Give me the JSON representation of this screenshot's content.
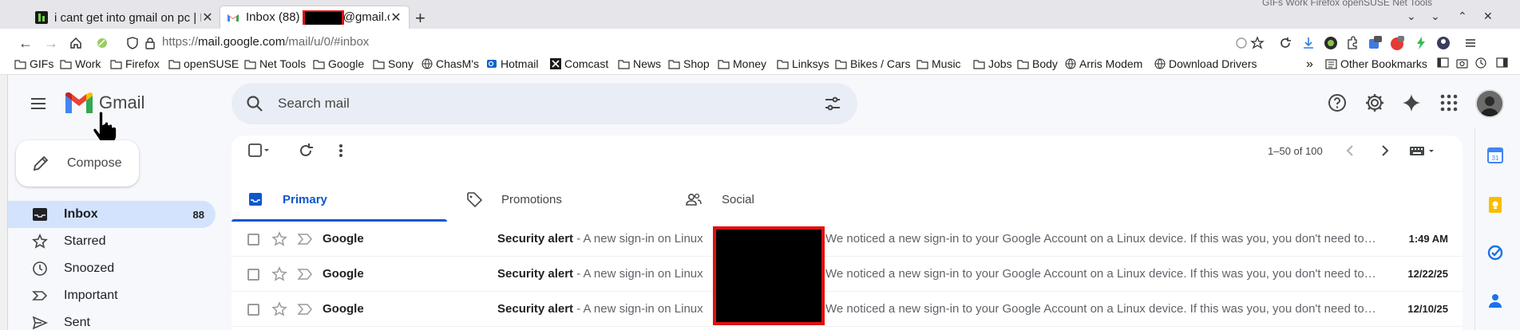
{
  "browser": {
    "bg_bookmarks_text": "GIFs   Work   Firefox   openSUSE   Net Tools",
    "tabs": [
      {
        "title": "i cant get into gmail on pc | F"
      },
      {
        "title_prefix": "Inbox (88)",
        "title_suffix": "@gmail.co"
      }
    ],
    "url_prefix": "https://",
    "url_host": "mail.google.com",
    "url_path": "/mail/u/0/#inbox",
    "bookmarks": [
      "GIFs",
      "Work",
      "Firefox",
      "openSUSE",
      "Net Tools",
      "Google",
      "Sony",
      "ChasM's",
      "Hotmail",
      "Comcast",
      "News",
      "Shop",
      "Money",
      "Linksys",
      "Bikes / Cars",
      "Music",
      "Jobs",
      "Body",
      "Arris Modem",
      "Download Drivers"
    ],
    "other_bookmarks": "Other Bookmarks"
  },
  "gmail": {
    "logo_text": "Gmail",
    "search_placeholder": "Search mail",
    "compose_label": "Compose",
    "sidebar": [
      {
        "label": "Inbox",
        "count": "88"
      },
      {
        "label": "Starred"
      },
      {
        "label": "Snoozed"
      },
      {
        "label": "Important"
      },
      {
        "label": "Sent"
      }
    ],
    "pager": "1–50 of 100",
    "tabs": [
      "Primary",
      "Promotions",
      "Social"
    ],
    "emails": [
      {
        "sender": "Google",
        "subject": "Security alert",
        "snippet_a": " - A new sign-in on Linux",
        "snippet_b": "We noticed a new sign-in to your Google Account on a Linux device. If this was you, you don't need to do anything.",
        "date": "1:49 AM"
      },
      {
        "sender": "Google",
        "subject": "Security alert",
        "snippet_a": " - A new sign-in on Linux",
        "snippet_b": "We noticed a new sign-in to your Google Account on a Linux device. If this was you, you don't need to do anything.",
        "date": "12/22/25"
      },
      {
        "sender": "Google",
        "subject": "Security alert",
        "snippet_a": " - A new sign-in on Linux",
        "snippet_b": "We noticed a new sign-in to your Google Account on a Linux device. If this was you, you don't need to do anything.",
        "date": "12/10/25"
      }
    ],
    "accent_color": "#0b57d0",
    "inbox_highlight": "#d3e3fd"
  }
}
